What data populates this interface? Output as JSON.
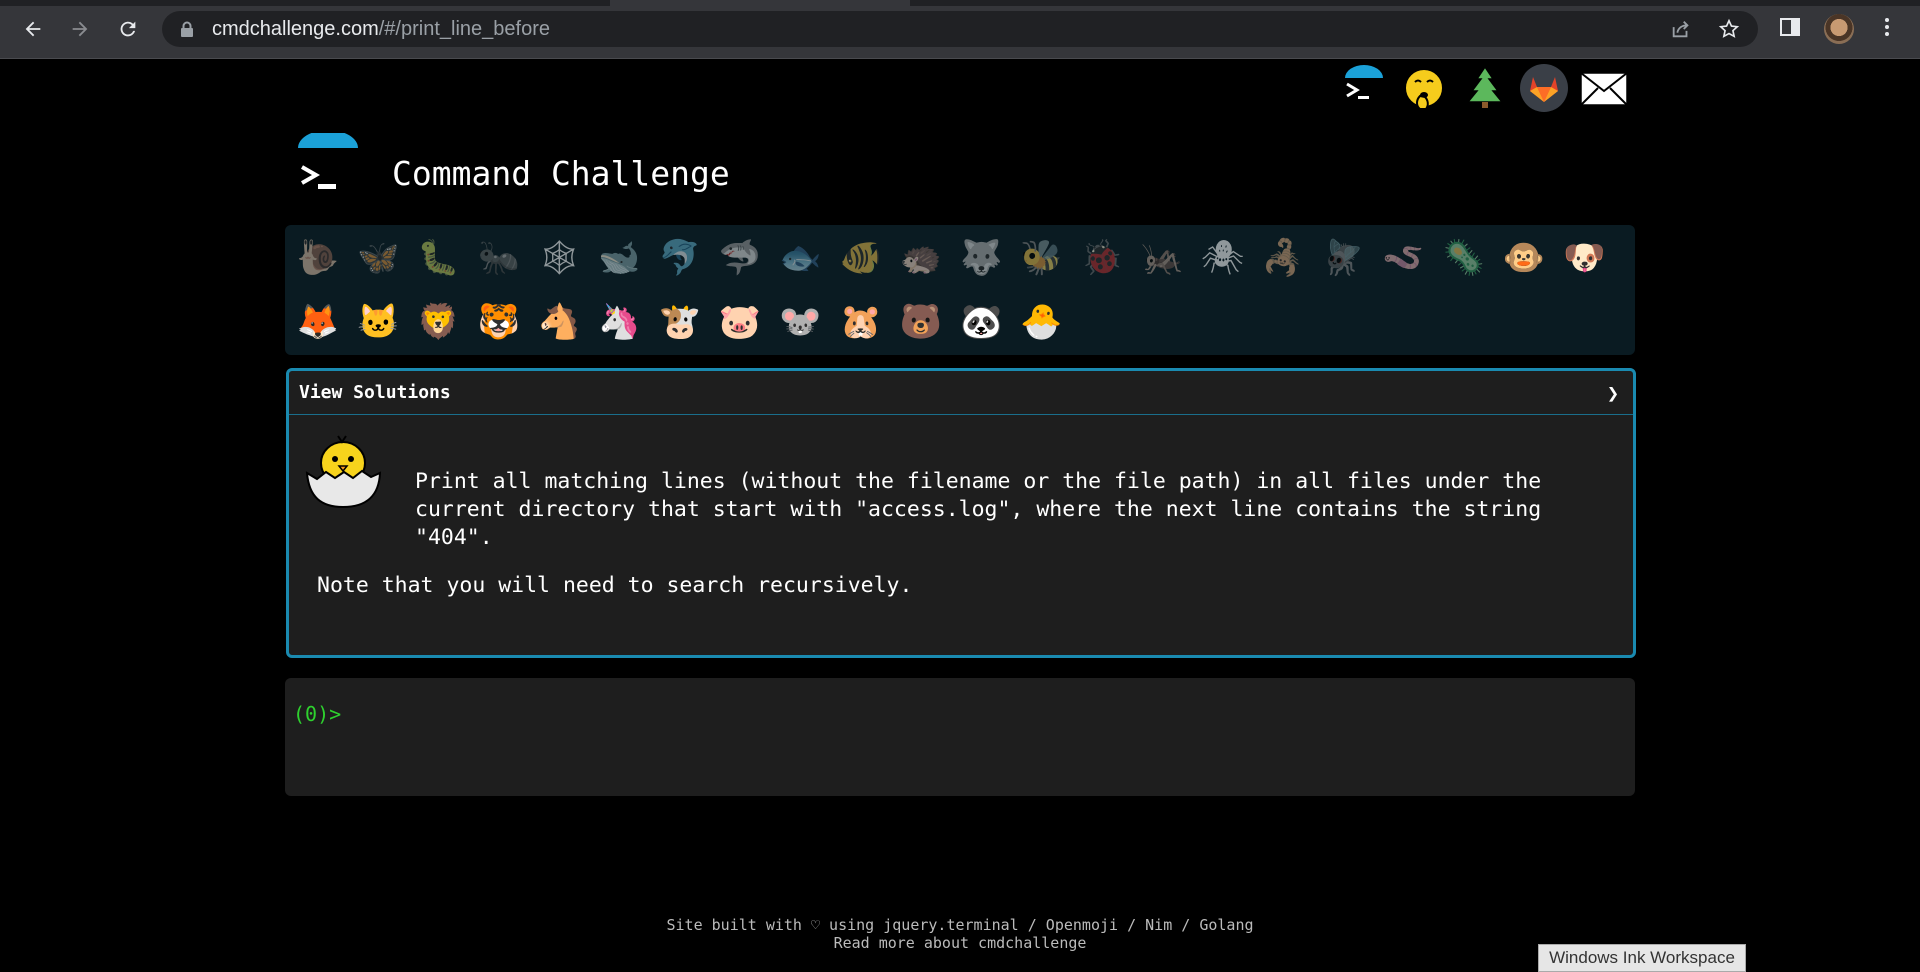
{
  "browser": {
    "url_host": "cmdchallenge.com",
    "url_path": "/#/print_line_before",
    "icons": [
      "back-arrow-icon",
      "forward-arrow-icon",
      "reload-icon",
      "lock-icon",
      "share-icon",
      "star-icon",
      "side-panel-icon",
      "profile-avatar",
      "kebab-menu-icon"
    ]
  },
  "top_links": {
    "icons": [
      "cmdchallenge-logo-icon",
      "shushing-face-icon",
      "evergreen-tree-icon",
      "gitlab-icon",
      "envelope-icon"
    ]
  },
  "site": {
    "title": "Command Challenge"
  },
  "challenge_emojis": [
    {
      "name": "snail",
      "glyph": "🐌",
      "solved": false
    },
    {
      "name": "butterfly",
      "glyph": "🦋",
      "solved": false
    },
    {
      "name": "bug",
      "glyph": "🐛",
      "solved": false
    },
    {
      "name": "ant",
      "glyph": "🐜",
      "solved": false
    },
    {
      "name": "spider-web",
      "glyph": "🕸",
      "solved": false
    },
    {
      "name": "whale",
      "glyph": "🐋",
      "solved": false
    },
    {
      "name": "dolphin",
      "glyph": "🐬",
      "solved": false
    },
    {
      "name": "shark",
      "glyph": "🦈",
      "solved": false
    },
    {
      "name": "fish",
      "glyph": "🐟",
      "solved": false
    },
    {
      "name": "tropical-fish",
      "glyph": "🐠",
      "solved": false
    },
    {
      "name": "hedgehog",
      "glyph": "🦔",
      "solved": false
    },
    {
      "name": "wolf",
      "glyph": "🐺",
      "solved": false
    },
    {
      "name": "bee",
      "glyph": "🐝",
      "solved": false
    },
    {
      "name": "ladybug",
      "glyph": "🐞",
      "solved": false
    },
    {
      "name": "cricket",
      "glyph": "🦗",
      "solved": false
    },
    {
      "name": "spider",
      "glyph": "🕷",
      "solved": false
    },
    {
      "name": "scorpion",
      "glyph": "🦂",
      "solved": false
    },
    {
      "name": "fly",
      "glyph": "🪰",
      "solved": false
    },
    {
      "name": "worm",
      "glyph": "🪱",
      "solved": false
    },
    {
      "name": "microbe",
      "glyph": "🦠",
      "solved": false
    },
    {
      "name": "monkey",
      "glyph": "🐵",
      "solved": true
    },
    {
      "name": "dog",
      "glyph": "🐶",
      "solved": true
    },
    {
      "name": "fox",
      "glyph": "🦊",
      "solved": true
    },
    {
      "name": "cat",
      "glyph": "🐱",
      "solved": true
    },
    {
      "name": "lion",
      "glyph": "🦁",
      "solved": true
    },
    {
      "name": "tiger",
      "glyph": "🐯",
      "solved": true
    },
    {
      "name": "horse",
      "glyph": "🐴",
      "solved": true
    },
    {
      "name": "unicorn",
      "glyph": "🦄",
      "solved": true
    },
    {
      "name": "cow",
      "glyph": "🐮",
      "solved": true
    },
    {
      "name": "pig",
      "glyph": "🐷",
      "solved": true
    },
    {
      "name": "mouse",
      "glyph": "🐭",
      "solved": true
    },
    {
      "name": "hamster",
      "glyph": "🐹",
      "solved": true
    },
    {
      "name": "bear",
      "glyph": "🐻",
      "solved": true
    },
    {
      "name": "panda",
      "glyph": "🐼",
      "solved": true
    },
    {
      "name": "hatching-chick",
      "glyph": "🐣",
      "solved": true
    }
  ],
  "challenge": {
    "solutions_label": "View Solutions",
    "chevron": "❯",
    "icon": "hatching-chick-icon",
    "description": "Print all matching lines (without the filename or the file path) in all files under the\ncurrent directory that start with \"access.log\", where the next line contains the string\n\"404\".",
    "note": "Note that you will need to search recursively."
  },
  "terminal": {
    "prompt": "(0)>"
  },
  "footer": {
    "line1": "Site built with ♡ using jquery.terminal / Openmoji / Nim / Golang",
    "line2": "Read more about cmdchallenge"
  },
  "overlay": {
    "ink_label": "Windows Ink Workspace"
  },
  "colors": {
    "accent": "#1a8ab0",
    "prompt_green": "#2ed12e",
    "panel_bg": "#0a1b22",
    "card_bg": "#1e1e1e"
  }
}
